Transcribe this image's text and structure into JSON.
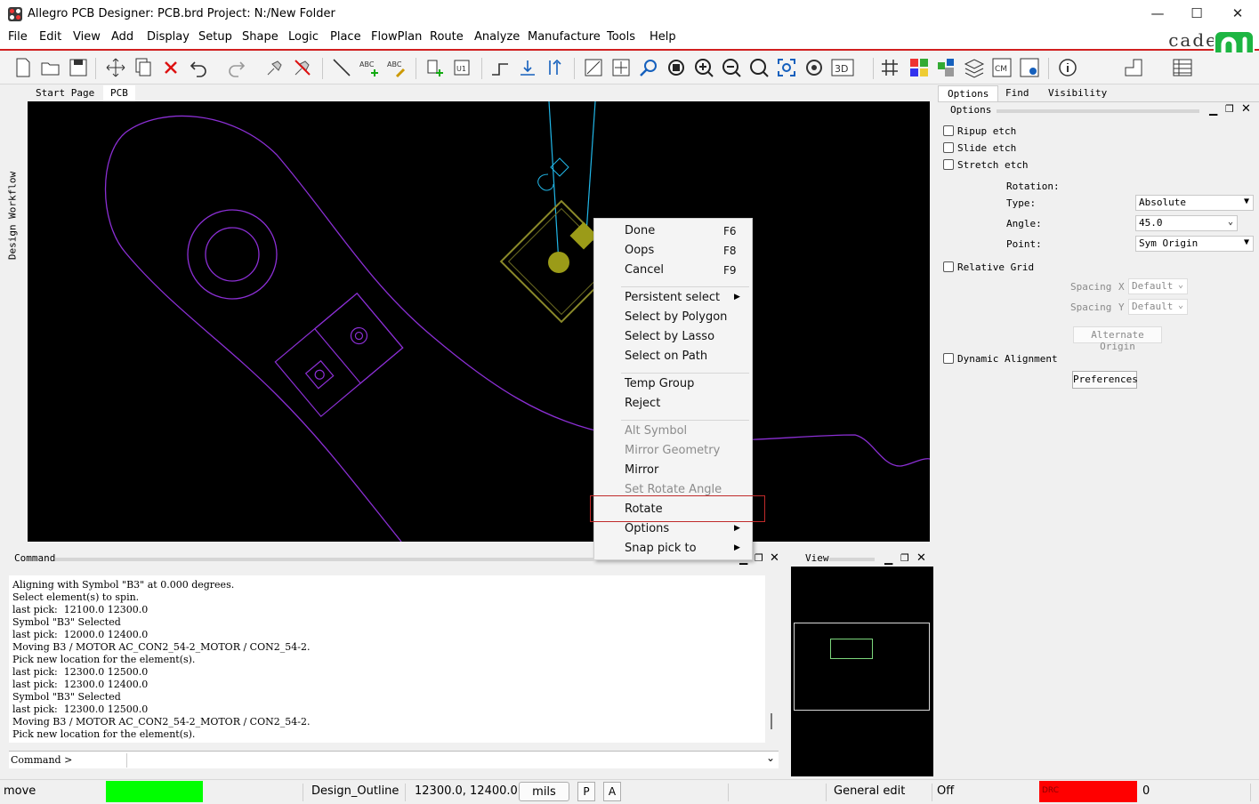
{
  "window": {
    "title": "Allegro PCB Designer: PCB.brd  Project: N:/New Folder",
    "controls": {
      "minimize": "—",
      "maximize": "☐",
      "close": "✕"
    }
  },
  "menubar": {
    "items": [
      "File",
      "Edit",
      "View",
      "Add",
      "Display",
      "Setup",
      "Shape",
      "Logic",
      "Place",
      "FlowPlan",
      "Route",
      "Analyze",
      "Manufacture",
      "Tools",
      "Help"
    ],
    "brand": "cade"
  },
  "toolbar": {
    "icons": [
      "new-file-icon",
      "open-folder-icon",
      "save-icon",
      "move-icon",
      "copy-icon",
      "delete-icon",
      "undo-icon",
      "redo-icon",
      "pin-icon",
      "unpin-icon",
      "add-line-icon",
      "add-text-icon",
      "edit-text-icon",
      "place-component-icon",
      "swap-component-icon",
      "move-connect-icon",
      "spread-icon",
      "align-icon",
      "unrats-icon",
      "rats-icon",
      "zoom-points-icon",
      "zoom-fit-icon",
      "zoom-in-icon",
      "zoom-out-icon",
      "zoom-world-icon",
      "zoom-selection-icon",
      "redraw-icon",
      "3d-view-icon",
      "grid-icon",
      "color-icon",
      "shadow-icon",
      "layers-icon",
      "cm-icon",
      "constraint-icon",
      "info-icon",
      "shape-icon",
      "table-icon"
    ],
    "label_3d": "3D"
  },
  "workflow": {
    "label": "Design Workflow"
  },
  "doc_tabs": [
    "Start Page",
    "PCB"
  ],
  "context_menu": {
    "items": [
      {
        "label": "Done",
        "key": "F6",
        "enabled": true
      },
      {
        "label": "Oops",
        "key": "F8",
        "enabled": true
      },
      {
        "label": "Cancel",
        "key": "F9",
        "enabled": true
      },
      {
        "label": "Persistent select",
        "submenu": true,
        "enabled": true
      },
      {
        "label": "Select by Polygon",
        "enabled": true
      },
      {
        "label": "Select by Lasso",
        "enabled": true
      },
      {
        "label": "Select on Path",
        "enabled": true
      },
      {
        "label": "Temp Group",
        "enabled": true
      },
      {
        "label": "Reject",
        "enabled": true
      },
      {
        "label": "Alt Symbol",
        "enabled": false
      },
      {
        "label": "Mirror Geometry",
        "enabled": false
      },
      {
        "label": "Mirror",
        "enabled": true
      },
      {
        "label": "Set Rotate Angle",
        "enabled": false
      },
      {
        "label": "Rotate",
        "enabled": true,
        "highlighted": true
      },
      {
        "label": "Options",
        "submenu": true,
        "enabled": true
      },
      {
        "label": "Snap pick to",
        "submenu": true,
        "enabled": true
      }
    ]
  },
  "options_panel": {
    "tabs": [
      "Options",
      "Find",
      "Visibility"
    ],
    "header": "Options",
    "ripup_etch": {
      "label": "Ripup etch",
      "checked": false
    },
    "slide_etch": {
      "label": "Slide etch",
      "checked": false
    },
    "stretch_etch": {
      "label": "Stretch etch",
      "checked": false
    },
    "rotation_label": "Rotation:",
    "type": {
      "label": "Type:",
      "value": "Absolute"
    },
    "angle": {
      "label": "Angle:",
      "value": "45.0"
    },
    "point": {
      "label": "Point:",
      "value": "Sym Origin"
    },
    "relative_grid": {
      "label": "Relative Grid",
      "checked": false
    },
    "spacing_x": {
      "label": "Spacing",
      "axis": "X",
      "value": "Default"
    },
    "spacing_y": {
      "label": "Spacing",
      "axis": "Y",
      "value": "Default"
    },
    "alternate_origin": "Alternate Origin",
    "dynamic_alignment": {
      "label": "Dynamic Alignment",
      "checked": false
    },
    "preferences": "Preferences"
  },
  "command_pane": {
    "title": "Command",
    "lines": [
      "Aligning with Symbol \"B3\" at 0.000 degrees.",
      "Select element(s) to spin.",
      "last pick:  12100.0 12300.0",
      "Symbol \"B3\" Selected",
      "last pick:  12000.0 12400.0",
      "Moving B3 / MOTOR AC_CON2_54-2_MOTOR / CON2_54-2.",
      "Pick new location for the element(s).",
      "last pick:  12300.0 12500.0",
      "last pick:  12300.0 12400.0",
      "Symbol \"B3\" Selected",
      "last pick:  12300.0 12500.0",
      "Moving B3 / MOTOR AC_CON2_54-2_MOTOR / CON2_54-2.",
      "Pick new location for the element(s)."
    ],
    "prompt": "Command >"
  },
  "view_pane": {
    "title": "View"
  },
  "statusbar": {
    "mode": "move",
    "mode_color": "#00ff00",
    "subclass": "Design_Outline",
    "coords": "12300.0, 12400.0",
    "units": "mils",
    "p_button": "P",
    "a_button": "A",
    "edit_mode": "General edit",
    "off_text": "Off",
    "drc_label": "DRC",
    "drc_color": "#ff0000",
    "drc_count": "0"
  }
}
